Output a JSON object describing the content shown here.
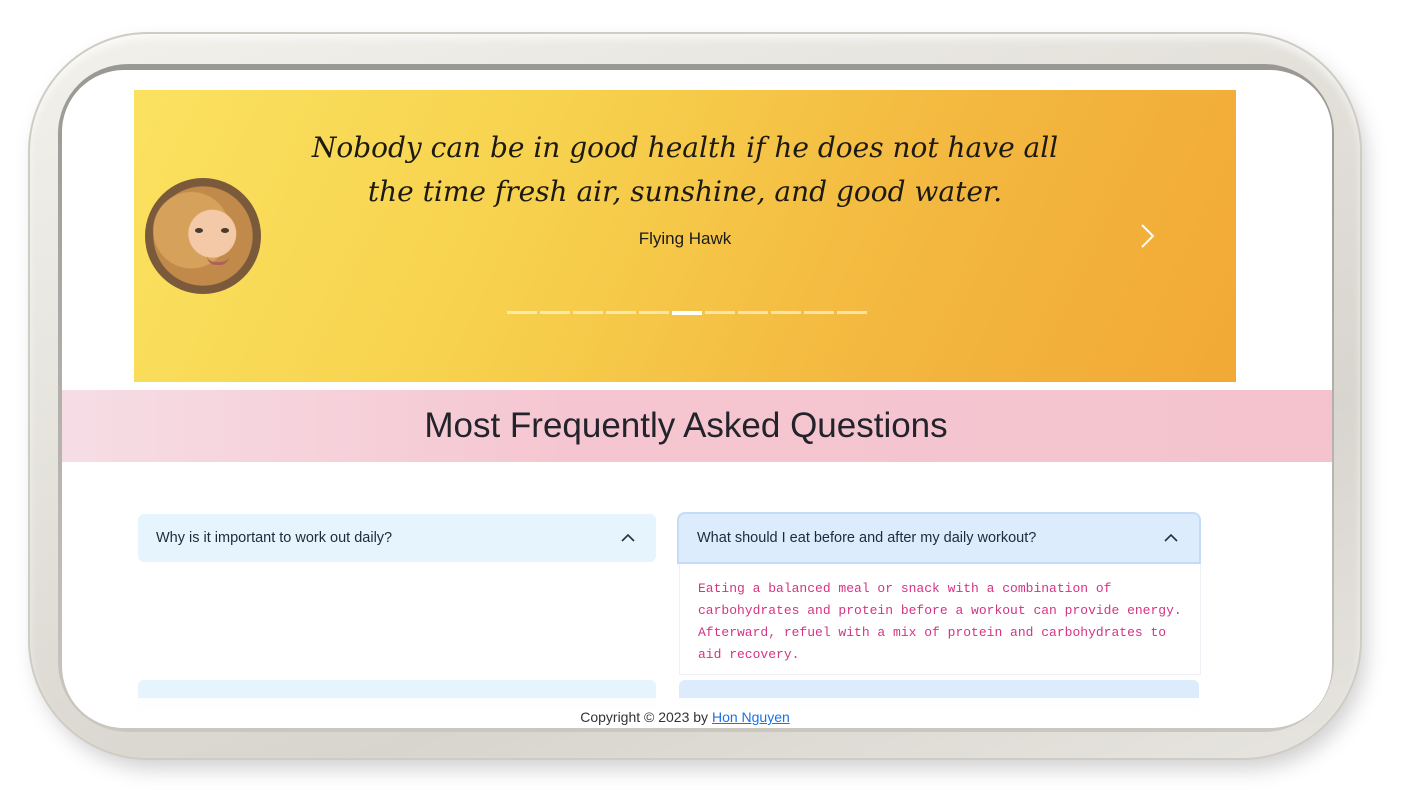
{
  "hero": {
    "quote": "Nobody can be in good health if he does not have all the time fresh air, sunshine, and good water.",
    "author": "Flying Hawk",
    "slide_count": 11,
    "active_slide": 6,
    "next_icon": "chevron-right-icon"
  },
  "faq": {
    "title": "Most Frequently Asked Questions",
    "items": [
      {
        "question": "Why is it important to work out daily?",
        "expanded": false
      },
      {
        "question": "What should I eat before and after my daily workout?",
        "expanded": true,
        "answer": "Eating a balanced meal or snack with a combination of carbohydrates and protein before a workout can provide energy. Afterward, refuel with a mix of protein and carbohydrates to aid recovery."
      }
    ],
    "chevron_icon": "chevron-up-icon"
  },
  "footer": {
    "prefix": "Copyright © 2023 by",
    "author_link": "Hon Nguyen"
  },
  "colors": {
    "hero_start": "#fae260",
    "hero_end": "#f1a935",
    "banner": "#f5c6d1",
    "answer_text": "#d63384",
    "link": "#1a73e8"
  }
}
